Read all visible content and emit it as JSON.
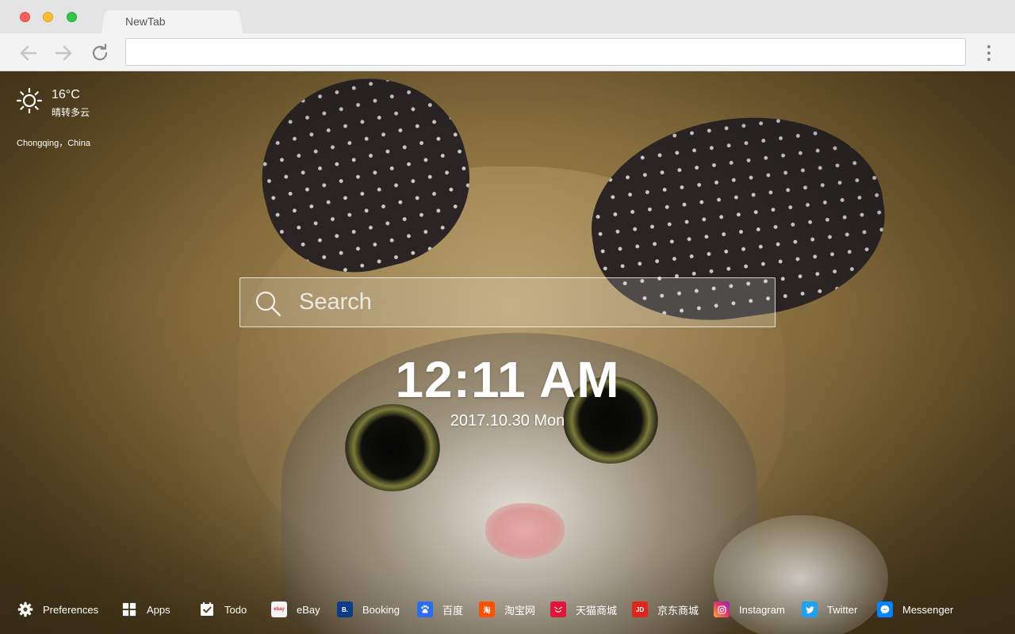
{
  "browser": {
    "tab_title": "NewTab",
    "address_value": ""
  },
  "weather": {
    "temperature": "16°C",
    "condition": "晴转多云",
    "location": "Chongqing，China",
    "icon": "sun-icon"
  },
  "search": {
    "placeholder": "Search"
  },
  "clock": {
    "time": "12:11 AM",
    "date": "2017.10.30 Mon"
  },
  "bottom_bar": {
    "items": [
      {
        "label": "Preferences",
        "icon": "gear-icon"
      },
      {
        "label": "Apps",
        "icon": "grid-icon"
      },
      {
        "label": "Todo",
        "icon": "todo-icon"
      },
      {
        "label": "eBay",
        "icon": "ebay-icon",
        "color": "#f4f4f4"
      },
      {
        "label": "Booking",
        "icon": "booking-icon",
        "color": "#0c3b8a"
      },
      {
        "label": "百度",
        "icon": "baidu-icon",
        "color": "#2a6df4"
      },
      {
        "label": "淘宝网",
        "icon": "taobao-icon",
        "color": "#ff5000"
      },
      {
        "label": "天猫商城",
        "icon": "tmall-icon",
        "color": "#e1143c"
      },
      {
        "label": "京东商城",
        "icon": "jd-icon",
        "color": "#e1251b"
      },
      {
        "label": "Instagram",
        "icon": "instagram-icon",
        "color": "#d6296f"
      },
      {
        "label": "Twitter",
        "icon": "twitter-icon",
        "color": "#1da1f2"
      },
      {
        "label": "Messenger",
        "icon": "messenger-icon",
        "color": "#0084ff"
      }
    ]
  }
}
